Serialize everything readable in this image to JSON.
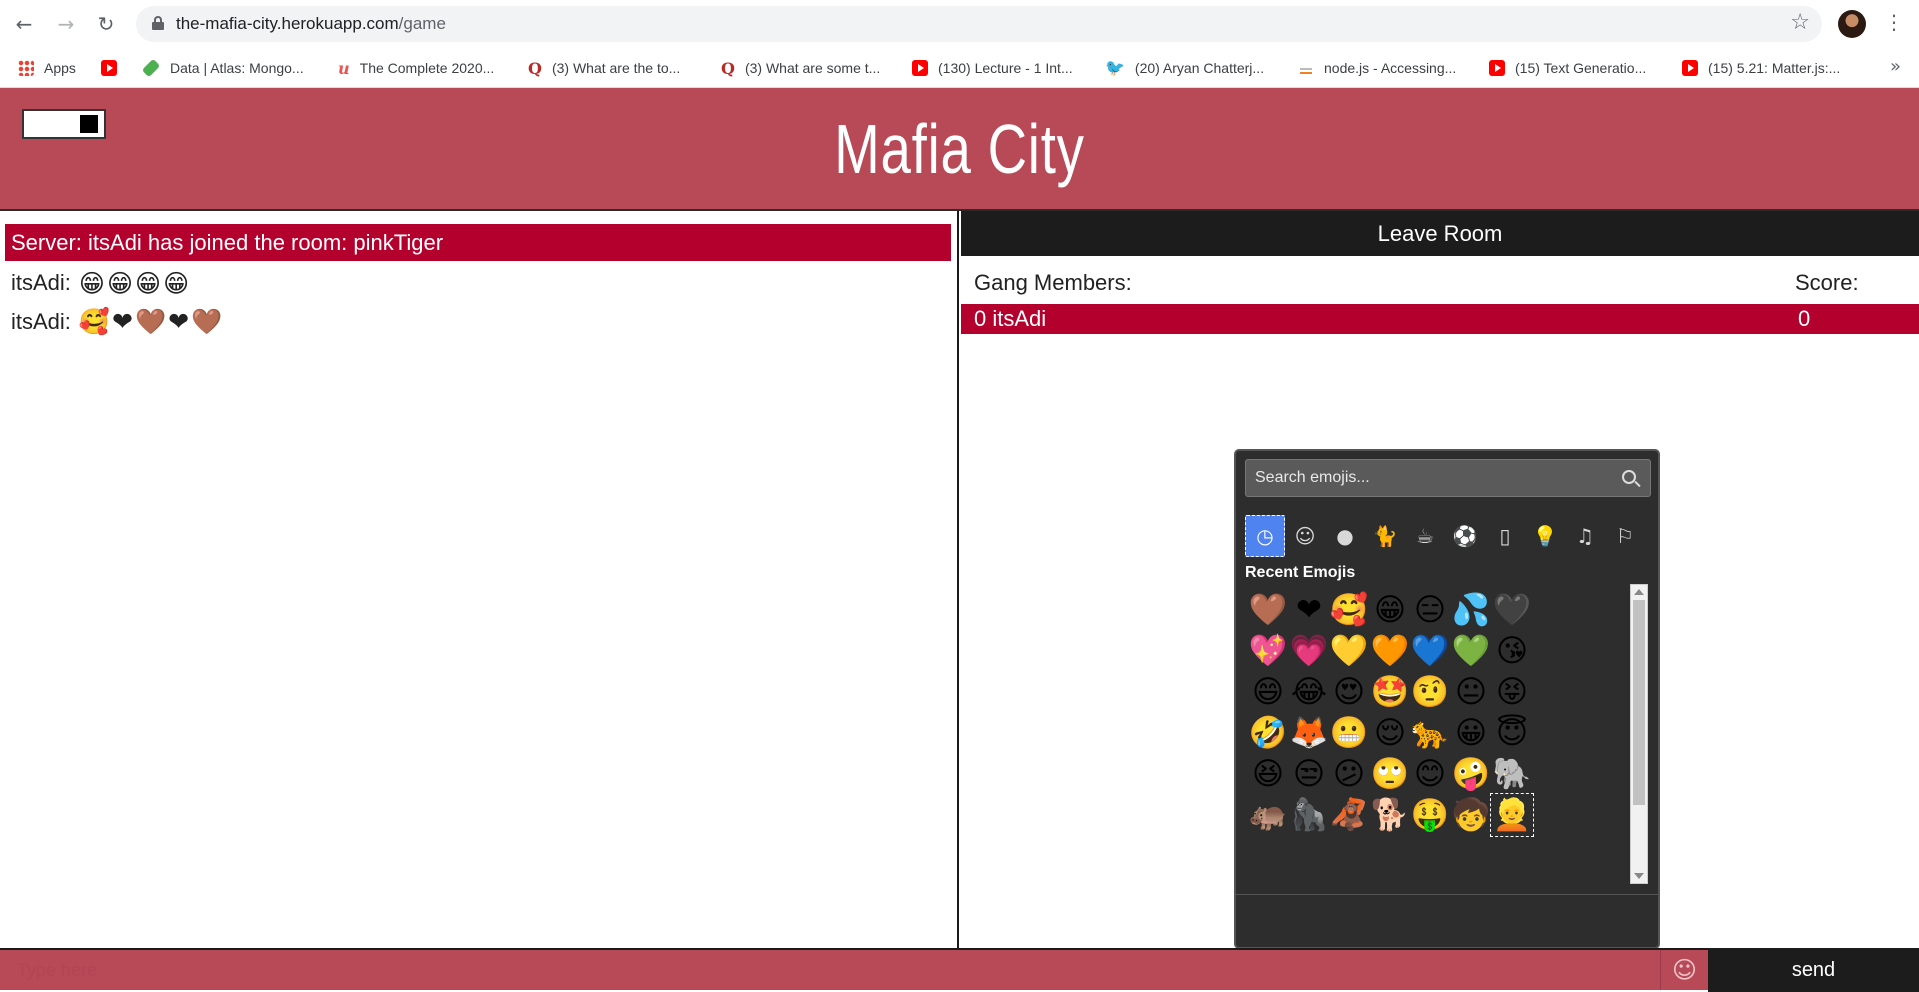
{
  "browser": {
    "url_host": "the-mafia-city.herokuapp.com",
    "url_path": "/game",
    "bookmarks": [
      {
        "label": "Apps",
        "icon": "apps-grid-icon"
      },
      {
        "label": "",
        "icon": "youtube-icon"
      },
      {
        "label": "Data | Atlas: Mongo...",
        "icon": "mongodb-leaf-icon"
      },
      {
        "label": "The Complete 2020...",
        "icon": "udemy-icon"
      },
      {
        "label": "(3) What are the to...",
        "icon": "quora-icon"
      },
      {
        "label": "(3) What are some t...",
        "icon": "quora-icon"
      },
      {
        "label": "(130) Lecture - 1 Int...",
        "icon": "youtube-icon"
      },
      {
        "label": "(20) Aryan Chatterj...",
        "icon": "twitter-icon"
      },
      {
        "label": "node.js - Accessing...",
        "icon": "stackoverflow-icon"
      },
      {
        "label": "(15) Text Generatio...",
        "icon": "youtube-icon"
      },
      {
        "label": "(15) 5.21: Matter.js:...",
        "icon": "youtube-icon"
      }
    ],
    "more": "»"
  },
  "app": {
    "title": "Mafia City"
  },
  "chat": {
    "server_message": "Server: itsAdi has joined the room: pinkTiger",
    "messages": [
      {
        "sender": "itsAdi:",
        "content": "😁😁😁😁"
      },
      {
        "sender": "itsAdi:",
        "content": "🥰❤🤎❤🤎"
      }
    ]
  },
  "room": {
    "leave_label": "Leave Room",
    "gang_label": "Gang Members:",
    "score_label": "Score:",
    "members": [
      {
        "name": "0 itsAdi",
        "score": "0"
      }
    ]
  },
  "emoji_picker": {
    "search_placeholder": "Search emojis...",
    "categories": [
      "recent-clock-icon",
      "smiley-icon",
      "person-icon",
      "animal-icon",
      "food-icon",
      "sport-icon",
      "building-icon",
      "object-icon",
      "music-icon",
      "flag-icon"
    ],
    "section_title": "Recent Emojis",
    "recent": [
      "🤎",
      "❤",
      "🥰",
      "😁",
      "😑",
      "💦",
      "🖤",
      "💖",
      "💗",
      "💛",
      "🧡",
      "💙",
      "💚",
      "😘",
      "😄",
      "😂",
      "😍",
      "🤩",
      "🤨",
      "😐",
      "😝",
      "🤣",
      "🦊",
      "😬",
      "😌",
      "🐆",
      "😀",
      "😇",
      "😆",
      "😒",
      "😕",
      "🙄",
      "😊",
      "🤪",
      "🐘",
      "🦛",
      "🦍",
      "🦧",
      "🐕",
      "🤑",
      "🧒",
      "👱"
    ]
  },
  "composer": {
    "placeholder": "Type here",
    "emoji_button": "☺",
    "send_label": "send"
  },
  "colors": {
    "header": "#b84a58",
    "accent_red": "#b4002d",
    "dark": "#1c1c1c",
    "picker_bg": "#2d2d2d",
    "picker_active": "#4f83f0"
  }
}
